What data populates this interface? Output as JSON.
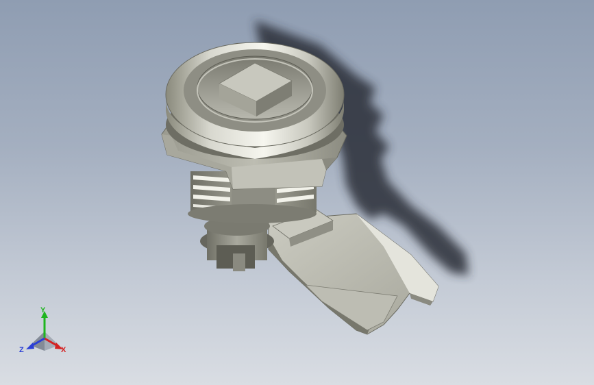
{
  "viewport": {
    "background_top": "#8f9db2",
    "background_bottom": "#d9dde3",
    "model": "quarter-turn-cam-lock-icon"
  },
  "triad": {
    "y_label": "Y",
    "x_label": "X",
    "z_label": "Z",
    "y_color": "#1fb51f",
    "x_color": "#d42323",
    "z_color": "#2a3fd6"
  }
}
